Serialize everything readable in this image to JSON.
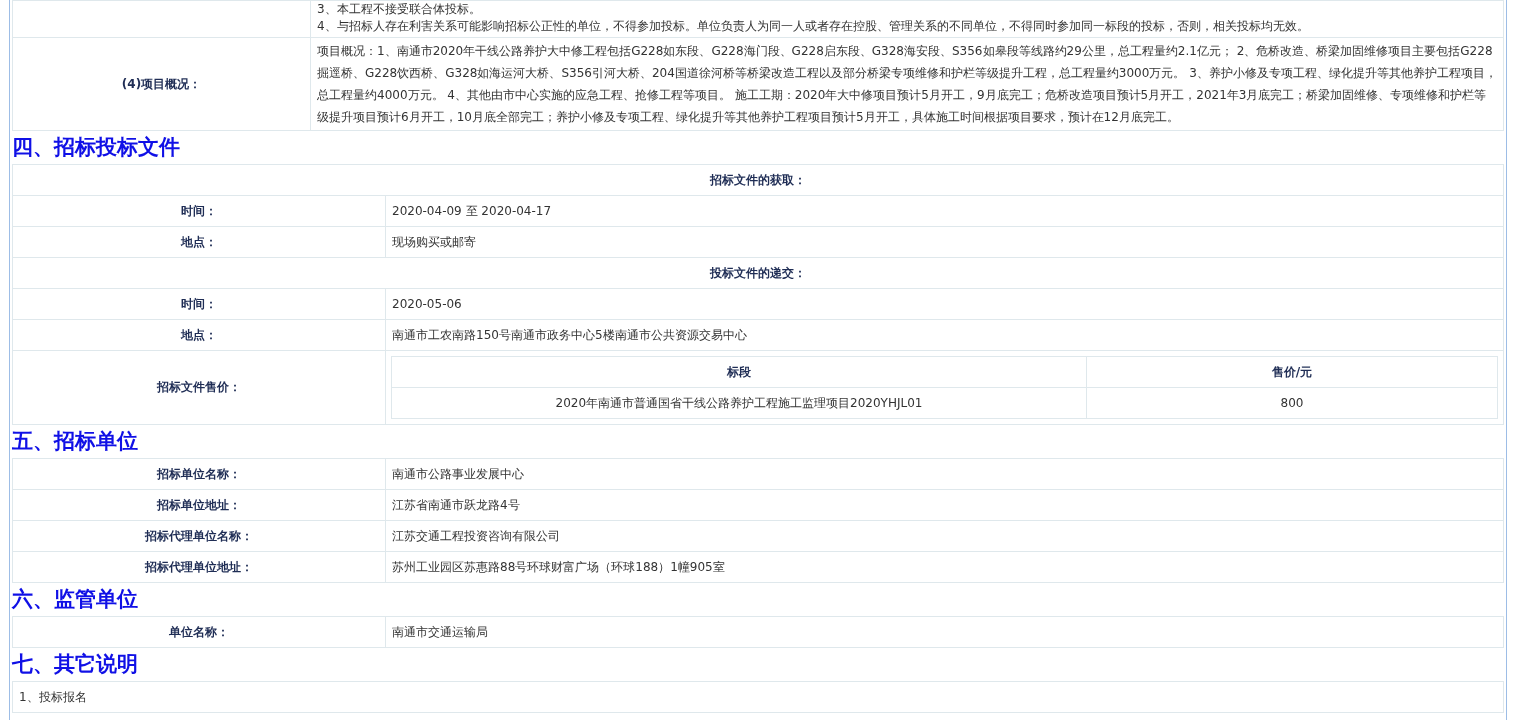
{
  "requirements_row": {
    "lines": [
      "3、本工程不接受联合体投标。",
      "4、与招标人存在利害关系可能影响招标公正性的单位，不得参加投标。单位负责人为同一人或者存在控股、管理关系的不同单位，不得同时参加同一标段的投标，否则，相关投标均无效。"
    ]
  },
  "overview_row": {
    "label": "(4)项目概况：",
    "text": "项目概况：1、南通市2020年干线公路养护大中修工程包括G228如东段、G228海门段、G228启东段、G328海安段、S356如皋段等线路约29公里，总工程量约2.1亿元； 2、危桥改造、桥梁加固维修项目主要包括G228掘逕桥、G228饮西桥、G328如海运河大桥、S356引河大桥、204国道徐河桥等桥梁改造工程以及部分桥梁专项维修和护栏等级提升工程，总工程量约3000万元。 3、养护小修及专项工程、绿化提升等其他养护工程项目，总工程量约4000万元。 4、其他由市中心实施的应急工程、抢修工程等项目。 施工工期：2020年大中修项目预计5月开工，9月底完工；危桥改造项目预计5月开工，2021年3月底完工；桥梁加固维修、专项维修和护栏等级提升项目预计6月开工，10月底全部完工；养护小修及专项工程、绿化提升等其他养护工程项目预计5月开工，具体施工时间根据项目要求，预计在12月底完工。"
  },
  "sections": [
    {
      "title": "四、招标投标文件",
      "rows": [
        {
          "kind": "header",
          "text": "招标文件的获取："
        },
        {
          "kind": "pair",
          "label": "时间：",
          "value": "2020-04-09 至 2020-04-17"
        },
        {
          "kind": "pair",
          "label": "地点：",
          "value": "现场购买或邮寄"
        },
        {
          "kind": "header",
          "text": "投标文件的递交："
        },
        {
          "kind": "pair",
          "label": "时间：",
          "value": "2020-05-06"
        },
        {
          "kind": "pair",
          "label": "地点：",
          "value": "南通市工农南路150号南通市政务中心5楼南通市公共资源交易中心"
        },
        {
          "kind": "price",
          "label": "招标文件售价：",
          "columns": [
            "标段",
            "售价/元"
          ],
          "rows": [
            [
              "2020年南通市普通国省干线公路养护工程施工监理项目2020YHJL01",
              "800"
            ]
          ]
        }
      ]
    },
    {
      "title": "五、招标单位",
      "rows": [
        {
          "kind": "pair",
          "label": "招标单位名称：",
          "value": "南通市公路事业发展中心"
        },
        {
          "kind": "pair",
          "label": "招标单位地址：",
          "value": "江苏省南通市跃龙路4号"
        },
        {
          "kind": "pair",
          "label": "招标代理单位名称：",
          "value": "江苏交通工程投资咨询有限公司"
        },
        {
          "kind": "pair",
          "label": "招标代理单位地址：",
          "value": "苏州工业园区苏惠路88号环球财富广场（环球188）1幢905室"
        }
      ]
    },
    {
      "title": "六、监管单位",
      "rows": [
        {
          "kind": "pair",
          "label": "单位名称：",
          "value": "南通市交通运输局"
        }
      ]
    },
    {
      "title": "七、其它说明",
      "rows": [
        {
          "kind": "note",
          "text": "1、投标报名"
        }
      ]
    }
  ]
}
